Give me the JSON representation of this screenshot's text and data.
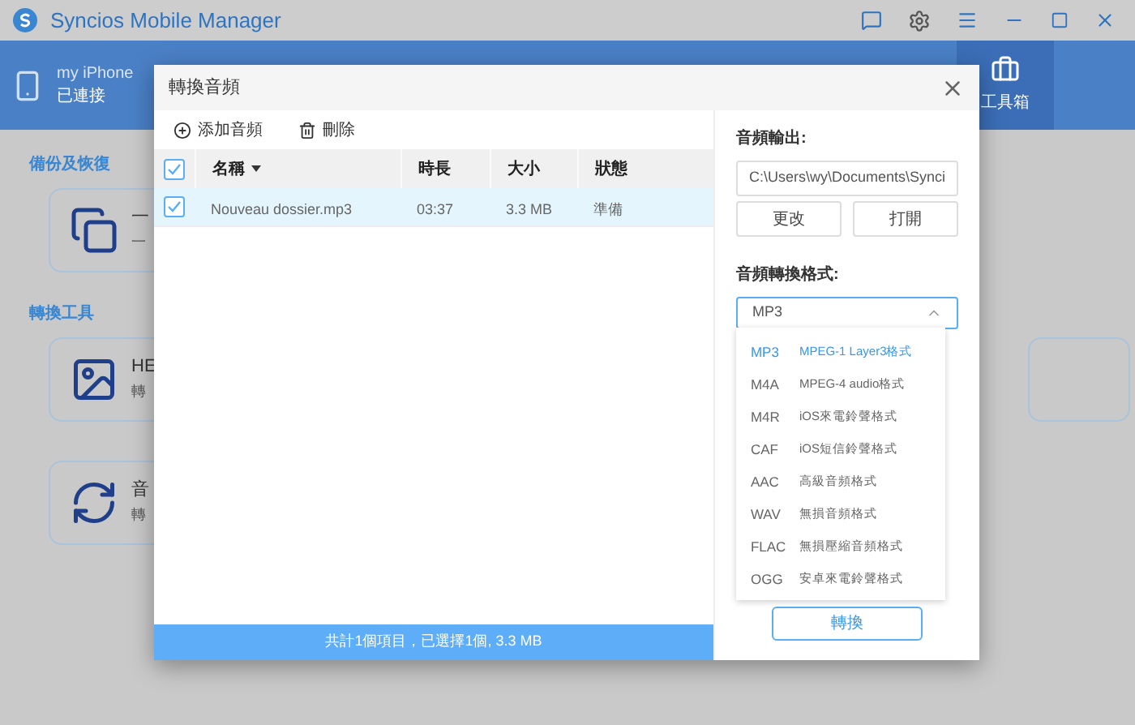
{
  "app": {
    "title": "Syncios Mobile Manager"
  },
  "device": {
    "name": "my iPhone",
    "status": "已連接"
  },
  "nav_tabs": [
    {
      "label": "工具箱",
      "selected": true
    }
  ],
  "sections": [
    {
      "heading": "備份及恢復",
      "cards": [
        {
          "kind": "backup",
          "title": "一",
          "subtitle": "一"
        }
      ]
    },
    {
      "heading": "轉換工具",
      "cards": [
        {
          "kind": "image",
          "title": "HE",
          "subtitle": "轉"
        },
        {
          "kind": "audio",
          "title": "音",
          "subtitle": "轉"
        }
      ]
    }
  ],
  "dialog": {
    "title": "轉換音頻",
    "toolbar": [
      {
        "kind": "add",
        "label": "添加音頻"
      },
      {
        "kind": "delete",
        "label": "刪除"
      }
    ],
    "table": {
      "all_checked": true,
      "columns": [
        "名稱",
        "時長",
        "大小",
        "狀態"
      ],
      "rows": [
        {
          "checked": true,
          "selected": true,
          "cells": [
            "Nouveau dossier.mp3",
            "03:37",
            "3.3 MB",
            "準備"
          ]
        }
      ]
    },
    "status_bar": "共計1個項目，已選擇1個, 3.3 MB",
    "output": {
      "label": "音頻輸出:",
      "path": "C:\\Users\\wy\\Documents\\Synci",
      "buttons": [
        "更改",
        "打開"
      ]
    },
    "format": {
      "label": "音頻轉換格式:",
      "value": "MP3",
      "expanded": true,
      "options": [
        {
          "code": "MP3",
          "description": "MPEG-1 Layer3格式",
          "selected": true
        },
        {
          "code": "M4A",
          "description": "MPEG-4 audio格式",
          "selected": false
        },
        {
          "code": "M4R",
          "description": "iOS來電鈴聲格式",
          "selected": false
        },
        {
          "code": "CAF",
          "description": "iOS短信鈴聲格式",
          "selected": false
        },
        {
          "code": "AAC",
          "description": "高級音頻格式",
          "selected": false
        },
        {
          "code": "WAV",
          "description": "無損音頻格式",
          "selected": false
        },
        {
          "code": "FLAC",
          "description": "無損壓縮音頻格式",
          "selected": false
        },
        {
          "code": "OGG",
          "description": "安卓來電鈴聲格式",
          "selected": false
        }
      ]
    },
    "convert_button": "轉換"
  }
}
